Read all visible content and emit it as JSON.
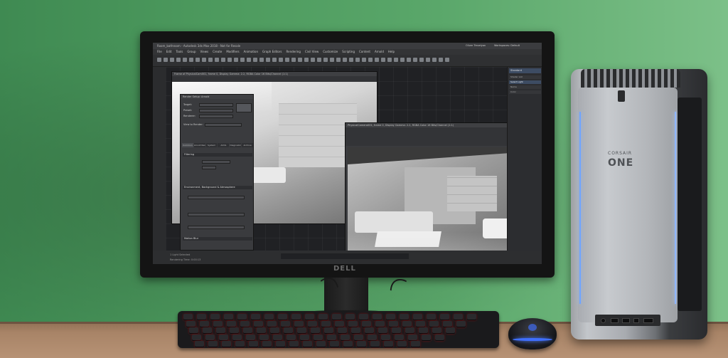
{
  "scene": {
    "colors": {
      "wall": "#4d9a5e",
      "desk": "#a88467",
      "monitor_frame": "#141414",
      "tower_silver": "#b3b6ba",
      "keyboard_backlight": "#ff2a2a",
      "mouse_led": "#3f6fff"
    }
  },
  "monitor": {
    "brand_logo": "DELL"
  },
  "app": {
    "title": "Room_bathroom - Autodesk 3ds Max 2018 - Not for Resale",
    "menu": [
      "File",
      "Edit",
      "Tools",
      "Group",
      "Views",
      "Create",
      "Modifiers",
      "Animation",
      "Graph Editors",
      "Rendering",
      "Civil View",
      "Customize",
      "Scripting",
      "Content",
      "Arnold",
      "Help"
    ],
    "account": "Oliver Trevelyan",
    "workspace": "Workspaces: Default",
    "status_left": "1 Light Selected",
    "status_sub": "Rendering Time: 0:00:13",
    "right_panel": {
      "header": "Standard",
      "rows": [
        "Shader List",
        "Select Light",
        "Name",
        "Color"
      ]
    },
    "render_dialog": {
      "title": "Render Setup: Arnold",
      "rows": [
        "Target:",
        "Preset:",
        "Renderer:",
        "View to Render:"
      ],
      "tabs": [
        "Common",
        "Arnold Renderer",
        "System",
        "AOVs",
        "Diagnostics",
        "Archive"
      ],
      "sections": [
        "Filtering",
        "Environment, Background & Atmosphere",
        "Motion Blur"
      ]
    },
    "render_window_1": {
      "title": "Frame of PhysicalCam001, frame 0, Display Gamma: 2.2, RGBA Color 16 Bits/Channel (1:1)"
    },
    "render_window_2": {
      "title": "PhysicalCamera001, frame 0, Display Gamma: 2.2, RGBA Color 16 Bits/Channel (1:1)"
    }
  },
  "tower": {
    "brand_small": "CORSAIR",
    "brand_large": "ONE"
  }
}
